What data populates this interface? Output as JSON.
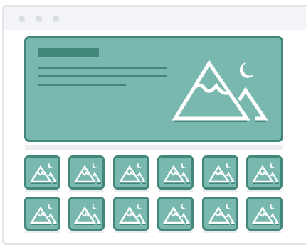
{
  "window": {
    "controls": [
      "close",
      "minimize",
      "maximize"
    ]
  },
  "hero": {
    "icon": "mountain-moon-image-icon",
    "placeholder_lines": 3
  },
  "gallery": {
    "rows": 2,
    "columns": 6,
    "thumbnail_icon": "mountain-moon-image-icon"
  },
  "colors": {
    "fill": "#78b8ae",
    "accent": "#42877a",
    "window_chrome": "#f3f4f7",
    "window_border": "#e3e5ea"
  }
}
